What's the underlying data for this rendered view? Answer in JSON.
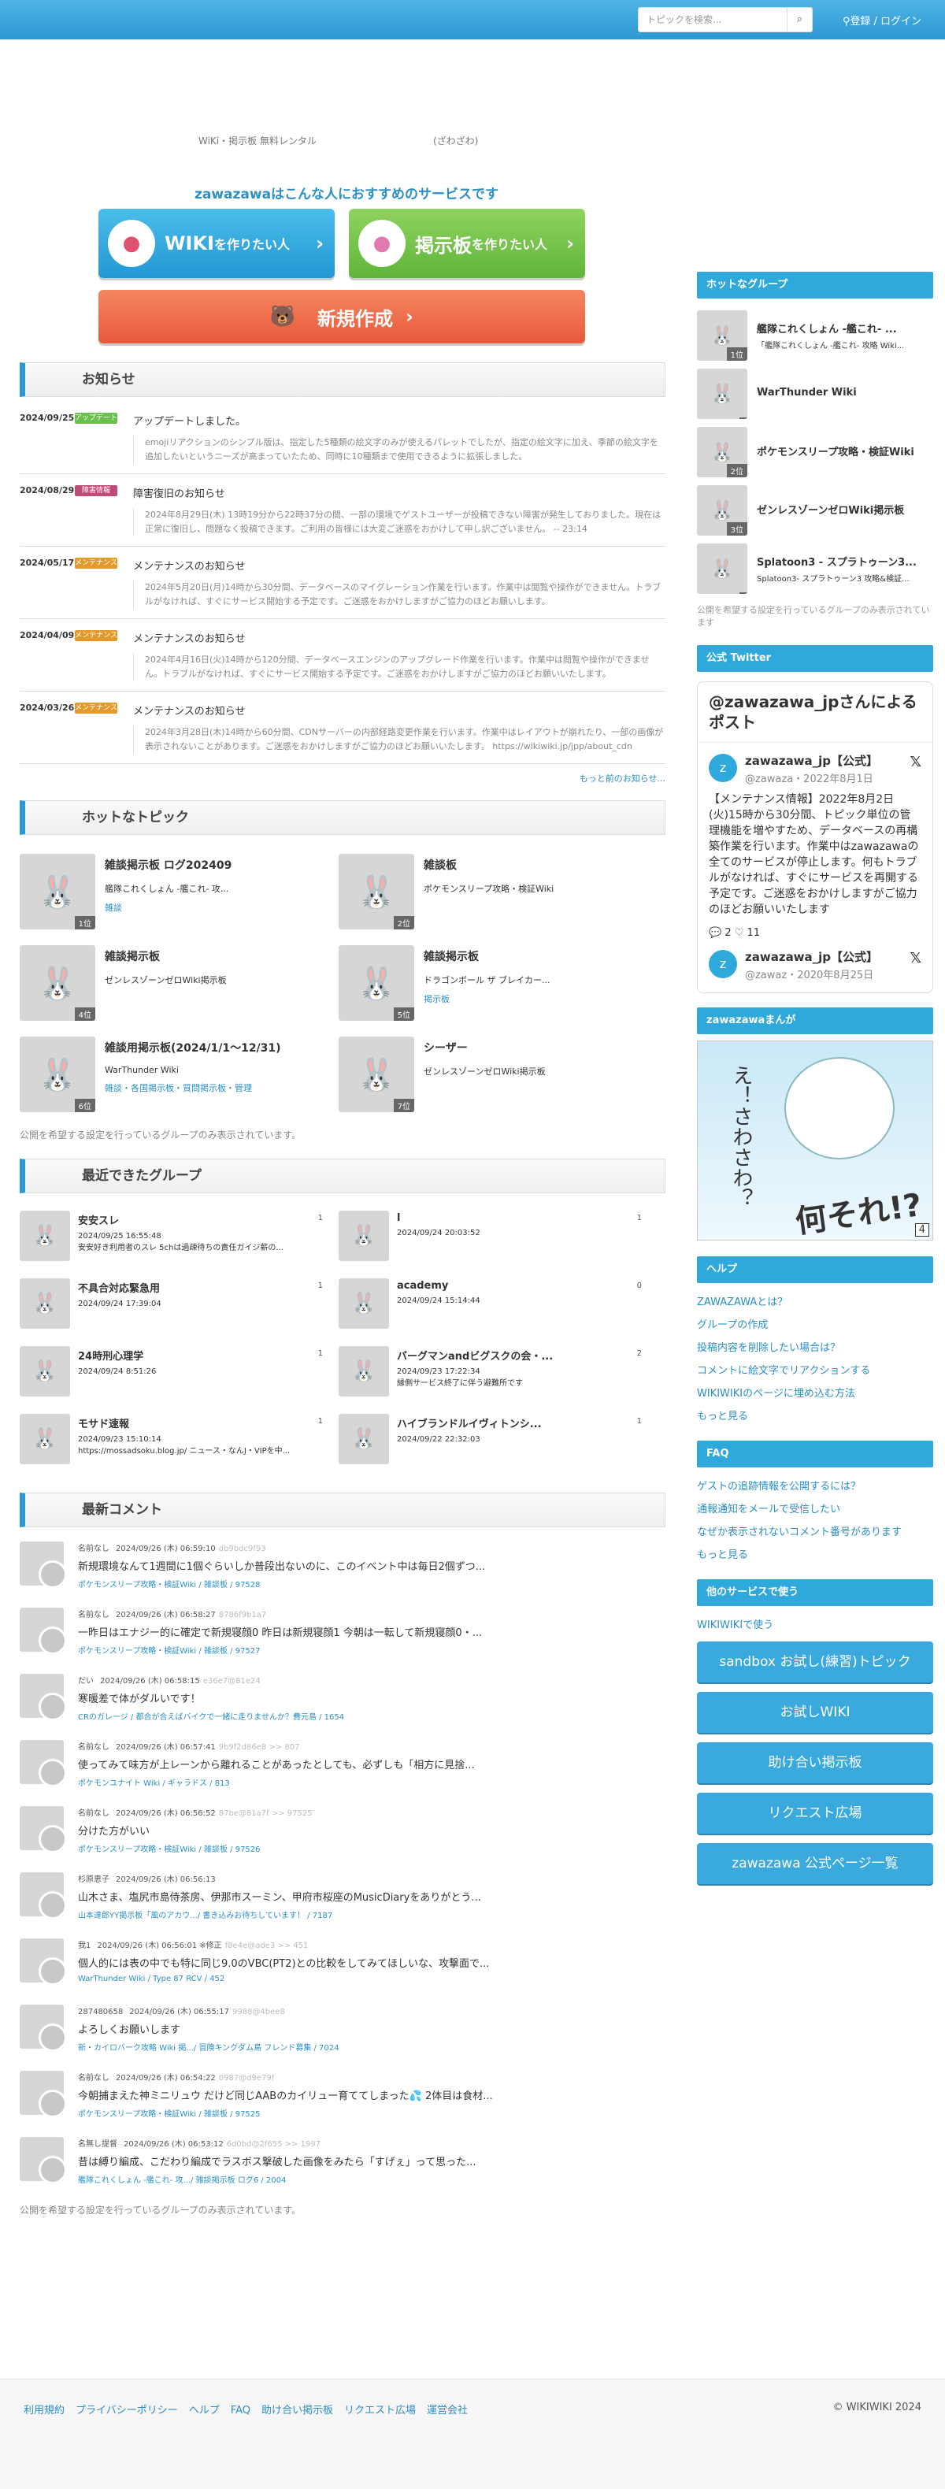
{
  "header": {
    "search_placeholder": "トピックを検索...",
    "search_button": "",
    "login": "登録 / ログイン"
  },
  "nav": {
    "left": "WiKi・掲示板 無料レンタル",
    "right": "(ざわざわ)"
  },
  "promo": {
    "title": "zawazawaはこんな人におすすめのサービスです",
    "wiki_btn": "WIKI",
    "wiki_sub": "を作りたい人",
    "bbs_btn": "掲示板",
    "bbs_sub": "を作りたい人",
    "new_btn": "新規作成"
  },
  "news": {
    "title": "お知らせ",
    "more": "もっと前のお知らせ...",
    "items": [
      {
        "date": "2024/09/25",
        "tag": "アップデート",
        "tag_color": "#6bbf4e",
        "title": "アップデートしました。",
        "desc": "emojiリアクションのシンプル版は、指定した5種類の絵文字のみが使えるパレットでしたが、指定の絵文字に加え、季節の絵文字を追加したいというニーズが高まっていたため、同時に10種類まで使用できるように拡張しました。"
      },
      {
        "date": "2024/08/29",
        "tag": "障害情報",
        "tag_color": "#c04a7a",
        "title": "障害復旧のお知らせ",
        "desc": "2024年8月29日(木) 13時19分から22時37分の間、一部の環境でゲストユーザーが投稿できない障害が発生しておりました。現在は正常に復旧し、問題なく投稿できます。ご利用の皆様には大変ご迷惑をおかけして申し訳ございません。 -- 23:14"
      },
      {
        "date": "2024/05/17",
        "tag": "メンテナンス",
        "tag_color": "#e19a2b",
        "title": "メンテナンスのお知らせ",
        "desc": "2024年5月20日(月)14時から30分間、データベースのマイグレーション作業を行います。作業中は閲覧や操作ができません。トラブルがなければ、すぐにサービス開始する予定です。ご迷惑をおかけしますがご協力のほどお願いします。"
      },
      {
        "date": "2024/04/09",
        "tag": "メンテナンス",
        "tag_color": "#e19a2b",
        "title": "メンテナンスのお知らせ",
        "desc": "2024年4月16日(火)14時から120分間、データベースエンジンのアップグレード作業を行います。作業中は閲覧や操作ができません。トラブルがなければ、すぐにサービス開始する予定です。ご迷惑をおかけしますがご協力のほどお願いいたします。"
      },
      {
        "date": "2024/03/26",
        "tag": "メンテナンス",
        "tag_color": "#e19a2b",
        "title": "メンテナンスのお知らせ",
        "desc": "2024年3月28日(木)14時から60分間、CDNサーバーの内部経路変更作業を行います。作業中はレイアウトが崩れたり、一部の画像が表示されないことがあります。ご迷惑をおかけしますがご協力のほどお願いいたします。 https://wikiwiki.jp/jpp/about_cdn"
      }
    ]
  },
  "hot_topics": {
    "title": "ホットなトピック",
    "note": "公開を希望する設定を行っているグループのみ表示されています。",
    "items": [
      {
        "title": "雑談掲示板 ログ202409",
        "group": "艦隊これくしょん -艦これ- 攻...",
        "tag": "雑談",
        "rank": "1位"
      },
      {
        "title": "雑談板",
        "group": "ポケモンスリープ攻略・検証Wiki",
        "tag": "",
        "rank": "2位"
      },
      {
        "title": "雑談掲示板",
        "group": "ゼンレスゾーンゼロWiki掲示板",
        "tag": "",
        "rank": "4位"
      },
      {
        "title": "雑談掲示板",
        "group": "ドラゴンボール ザ ブレイカー...",
        "tag": "掲示板",
        "rank": "5位"
      },
      {
        "title": "雑談用掲示板(2024/1/1～12/31)",
        "group": "WarThunder Wiki",
        "tag": "雑談・各国掲示板・質問掲示板・管理",
        "rank": "6位"
      },
      {
        "title": "シーザー",
        "group": "ゼンレスゾーンゼロWiki掲示板",
        "tag": "",
        "rank": "7位"
      }
    ]
  },
  "recent_groups": {
    "title": "最近できたグループ",
    "items": [
      {
        "title": "安安スレ",
        "date": "2024/09/25 16:55:48",
        "desc": "安安好き利用者のスレ 5chは過疎待ちの責任ガイジ薪の...",
        "count": "1"
      },
      {
        "title": "l",
        "date": "2024/09/24 20:03:52",
        "desc": "",
        "count": "1"
      },
      {
        "title": "不具合対応緊急用",
        "date": "2024/09/24 17:39:04",
        "desc": "",
        "count": "1"
      },
      {
        "title": "academy",
        "date": "2024/09/24 15:14:44",
        "desc": "",
        "count": "0"
      },
      {
        "title": "24時刑心理学",
        "date": "2024/09/24 8:51:26",
        "desc": "",
        "count": "1"
      },
      {
        "title": "バーグマンandビグスクの会・...",
        "date": "2024/09/23 17:22:34",
        "desc": "縁側サービス終了に伴う避難所です",
        "count": "2"
      },
      {
        "title": "モサド速報",
        "date": "2024/09/23 15:10:14",
        "desc": "https://mossadsoku.blog.jp/ ニュース・なんJ・VIPを中...",
        "count": "1"
      },
      {
        "title": "ハイブランドルイヴィトンシ...",
        "date": "2024/09/22 22:32:03",
        "desc": "",
        "count": "1"
      }
    ]
  },
  "comments": {
    "title": "最新コメント",
    "note": "公開を希望する設定を行っているグループのみ表示されています。",
    "items": [
      {
        "name": "名前なし",
        "time": "2024/09/26 (木) 06:59:10",
        "hash": "db9bdc9f93",
        "text": "新規環境なんて1週間に1個ぐらいしか普段出ないのに、このイベント中は毎日2個ずつ...",
        "src": "ポケモンスリープ攻略・検証Wiki / 雑談板 / 97528"
      },
      {
        "name": "名前なし",
        "time": "2024/09/26 (木) 06:58:27",
        "hash": "8786f9b1a7",
        "text": "一昨日はエナジー的に確定で新規寝顔0 昨日は新規寝顔1 今朝は一転して新規寝顔0・...",
        "src": "ポケモンスリープ攻略・検証Wiki / 雑談板 / 97527"
      },
      {
        "name": "だい",
        "time": "2024/09/26 (木) 06:58:15",
        "hash": "e36e7@81e24",
        "text": "寒暖差で体がダルいです！",
        "src": "CRのガレージ / 都合が合えばバイクで一緒に走りませんか？費元島 / 1654"
      },
      {
        "name": "名前なし",
        "time": "2024/09/26 (木) 06:57:41",
        "hash": "9b9f2d86e8 >> 807",
        "text": "使ってみて味方が上レーンから離れることがあったとしても、必ずしも「相方に見捨...",
        "src": "ポケモンユナイト Wiki / ギャラドス / 813"
      },
      {
        "name": "名前なし",
        "time": "2024/09/26 (木) 06:56:52",
        "hash": "87be@81a7f >> 97525",
        "text": "分けた方がいい",
        "src": "ポケモンスリープ攻略・検証Wiki / 雑談板 / 97526"
      },
      {
        "name": "杉原恵子",
        "time": "2024/09/26 (木) 06:56:13",
        "hash": "",
        "text": "山木さま、塩尻市島侍茶房、伊那市スーミン、甲府市桜座のMusicDiaryをありがとう...",
        "src": "山本達郎YY掲示板「風のアカウ.../ 書き込みお待ちしています！ / 7187"
      },
      {
        "name": "我1",
        "time": "2024/09/26 (木) 06:56:01 ※修正",
        "hash": "f8e4e@ade3 >> 451",
        "text": "個人的には表の中でも特に同じ9.0のVBC(PT2)との比較をしてみてほしいな、攻撃面で...",
        "src": "WarThunder Wiki / Type 87 RCV / 452"
      },
      {
        "name": "287480658",
        "time": "2024/09/26 (木) 06:55:17",
        "hash": "9988@4bee8",
        "text": "よろしくお願いします",
        "src": "新・カイロバーク攻略 Wiki 掲.../ 冒険キングダム島 フレンド募集 / 7024"
      },
      {
        "name": "名前なし",
        "time": "2024/09/26 (木) 06:54:22",
        "hash": "0987@d9e79f",
        "text": "今朝捕まえた神ミニリュウ だけど同じAABのカイリュー育ててしまった💦 2体目は食材...",
        "src": "ポケモンスリープ攻略・検証Wiki / 雑談板 / 97525"
      },
      {
        "name": "名無し提督",
        "time": "2024/09/26 (木) 06:53:12",
        "hash": "6d0bd@2f655 >> 1997",
        "text": "昔は縛り編成、こだわり編成でラスボス撃破した画像をみたら「すげぇ」って思った...",
        "src": "艦隊これくしょん -艦これ- 攻.../ 雑談掲示板 ログ6 / 2004"
      }
    ]
  },
  "side": {
    "hot_groups": {
      "title": "ホットなグループ",
      "note": "公開を希望する設定を行っているグループのみ表示されています",
      "items": [
        {
          "title": "艦隊これくしょん -艦これ- ...",
          "sub": "「艦隊これくしょん -艦これ- 攻略 Wiki...",
          "rank": "1位"
        },
        {
          "title": "WarThunder Wiki",
          "sub": "",
          "rank": ""
        },
        {
          "title": "ポケモンスリープ攻略・検証Wiki",
          "sub": "",
          "rank": "2位"
        },
        {
          "title": "ゼンレスゾーンゼロWiki掲示板",
          "sub": "",
          "rank": "3位"
        },
        {
          "title": "Splatoon3 - スプラトゥーン3...",
          "sub": "Splatoon3- スプラトゥーン3 攻略&検証...",
          "rank": ""
        }
      ]
    },
    "twitter": {
      "title": "公式 Twitter",
      "header": "@zawazawa_jpさんによるポスト",
      "tweets": [
        {
          "name": "zawazawa_jp【公式】",
          "sub": "@zawaza・2022年8月1日",
          "text": "【メンテナンス情報】2022年8月2日(火)15時から30分間、トピック単位の管理機能を増やすため、データベースの再構築作業を行います。作業中はzawazawaの全てのサービスが停止します。何もトラブルがなければ、すぐにサービスを再開する予定です。ご迷惑をおかけしますがご協力のほどお願いいたします",
          "likes": "2",
          "retweets": "11"
        },
        {
          "name": "zawazawa_jp【公式】",
          "sub": "@zawaz・2020年8月25日",
          "text": "",
          "likes": "",
          "retweets": ""
        }
      ]
    },
    "manga": {
      "title": "zawazawaまんが",
      "t1": "え！さわさわ？",
      "t2": "何それ!?",
      "num": "4"
    },
    "help": {
      "title": "ヘルプ",
      "links": [
        "ZAWAZAWAとは？",
        "グループの作成",
        "投稿内容を削除したい場合は？",
        "コメントに絵文字でリアクションする",
        "WIKIWIKIのページに埋め込む方法",
        "もっと見る"
      ]
    },
    "faq": {
      "title": "FAQ",
      "links": [
        "ゲストの追跡情報を公開するには？",
        "通報通知をメールで受信したい",
        "なぜか表示されないコメント番号があります",
        "もっと見る"
      ]
    },
    "services": {
      "title": "他のサービスで使う",
      "link": "WIKIWIKIで使う",
      "buttons": [
        "sandbox お試し(練習)トピック",
        "お試しWIKI",
        "助け合い掲示板",
        "リクエスト広場",
        "zawazawa 公式ページ一覧"
      ]
    }
  },
  "footer": {
    "links": [
      "利用規約",
      "プライバシーポリシー",
      "ヘルプ",
      "FAQ",
      "助け合い掲示板",
      "リクエスト広場",
      "運営会社"
    ],
    "copyright": "© WIKIWIKI 2024"
  }
}
